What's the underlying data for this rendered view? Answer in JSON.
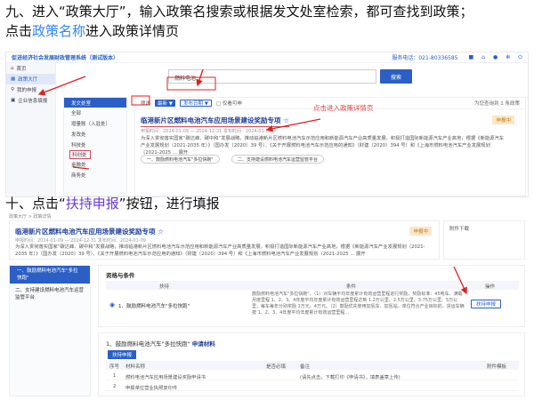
{
  "steps": {
    "step9_line1": "九、进入“政策大厅”，输入政策名搜索或根据发文处室检索，都可查找到政策；",
    "step9_line2_pre": "点击",
    "step9_line2_link": "政策名称",
    "step9_line2_post": "进入政策详情页",
    "step10_pre": "十、点击“",
    "step10_link": "扶持申报",
    "step10_post": "”按钮，进行填报"
  },
  "shot1": {
    "brand": "促进经济社会发展财政管理系统（测试版本）",
    "hotline": "服务电话：021-80336585",
    "top_icons": [
      "bell-icon",
      "home-icon",
      "user-icon",
      "settings-icon",
      "power-icon"
    ],
    "nav": [
      {
        "icon": "home-icon",
        "label": "首页"
      },
      {
        "icon": "grid-icon",
        "label": "政策大厅",
        "active": true
      },
      {
        "icon": "search-icon",
        "label": "我的申报"
      },
      {
        "icon": "building-icon",
        "label": "企业信息填报"
      }
    ],
    "search_value": "燃料电池",
    "search_button": "搜索",
    "category_head": "发文处室",
    "categories": [
      "全部",
      "增量账（入驻处）",
      "发改处",
      "科技处",
      "科创处",
      "金融处",
      "商务处"
    ],
    "selected_category": "科创处",
    "filter": {
      "label": "筛选",
      "tag1": "最新 ▼",
      "tag2": "发布日期 ▼",
      "checkbox": "□ 仅看可申",
      "count": "为您查询到 1 条政策"
    },
    "policy_title": "临港新片区燃料电池汽车应用场景建设奖励专项 ☆",
    "policy_badge": "申报中",
    "policy_meta": "申报时间：2024-01-09 — 2024-12-31   发布时间：2024-01-09",
    "policy_desc": "为深入贯彻落实国家“碳达峰、碳中和”发展战略，推动临港新片区燃料电池汽车示范应用和新能源汽车产业高质量发展，积极打造国际新能源汽车产业高地，根据《新能源汽车产业发展规划（2021-2035 年）》（国办发〔2020〕39 号）、《关于开展燃料电池汽车示范应用的通知》（财建〔2020〕394 号）和《上海市燃料电池汽车产业发展规划（2021-2025 ... 展开",
    "chip1": "一、鼓励燃料电池汽车\"多拉快跑\"",
    "chip2": "二、支持建设燃料电池汽车运营监管平台",
    "annotation": "点击进入政策详情页"
  },
  "shot2": {
    "breadcrumb": "政策大厅 > 政策详情",
    "title": "临港新片区燃料电池汽车应用场景建设奖励专项 ☆",
    "badge": "申报中",
    "meta": "申报时间：2024-01-09 — 2024-12-31   发布时间：2024-01-09",
    "desc": "为深入贯彻落实国家“碳达峰、碳中和”发展战略，推动临港新片区燃料电池汽车示范应用和新能源汽车产业高质量发展，积极打造国际新能源汽车产业高地，根据《新能源汽车产业发展规划（2021-2035 年）》（国办发〔2020〕39 号）、《关于开展燃料电池汽车示范应用的通知》（财建〔2020〕394 号）和《上海市燃料电池汽车产业发展规划（2021-2025 ... 展开",
    "side_label": "附件下载",
    "left_item1": "一、鼓励燃料电池汽车\"多拉快跑\"",
    "left_item2": "二、支持建设燃料电池汽车运营监管平台",
    "qual_title": "资格与条件",
    "qual_cols": [
      "扶持",
      "条件",
      "操作"
    ],
    "qual_item": "1、鼓励燃料电池汽车\"多拉快跑\"",
    "qual_cond": "鼓励燃料电池汽车\"多拉快跑\"。（1）对车辆平均年度累计有效运营里程进行奖励，奖励标准：45吨车、满载月度里程 1、2、3、4年度平均年度累计有效运营里程达到 1.2万公里、2.5万公里、3.75万公里、5万公里，每车每年分别奖励 1万元、4万元。（2）鼓励优先使用加氢车、加氢站。单位符合产业目标的，货运车辆按 1、2、3、4年度平均年度累计有效运营里程...",
    "apply_button": "扶持申报",
    "mat_title_pre": "1、鼓励燃料电池汽车\"多拉快跑\"",
    "mat_title_bold": "申请材料",
    "mat_tab": "扶持申报",
    "mat_cols": [
      "序号",
      "材料名称",
      "是否必填",
      "备注",
      "附件模板"
    ],
    "mat_rows": [
      [
        "1",
        "燃料电池汽车应用场景建设奖励申请书",
        "",
        "(请先点击，下载打印《申请书》，填表盖章上传)",
        ""
      ],
      [
        "2",
        "申报单位营业执照复印件",
        "",
        "",
        ""
      ]
    ]
  }
}
